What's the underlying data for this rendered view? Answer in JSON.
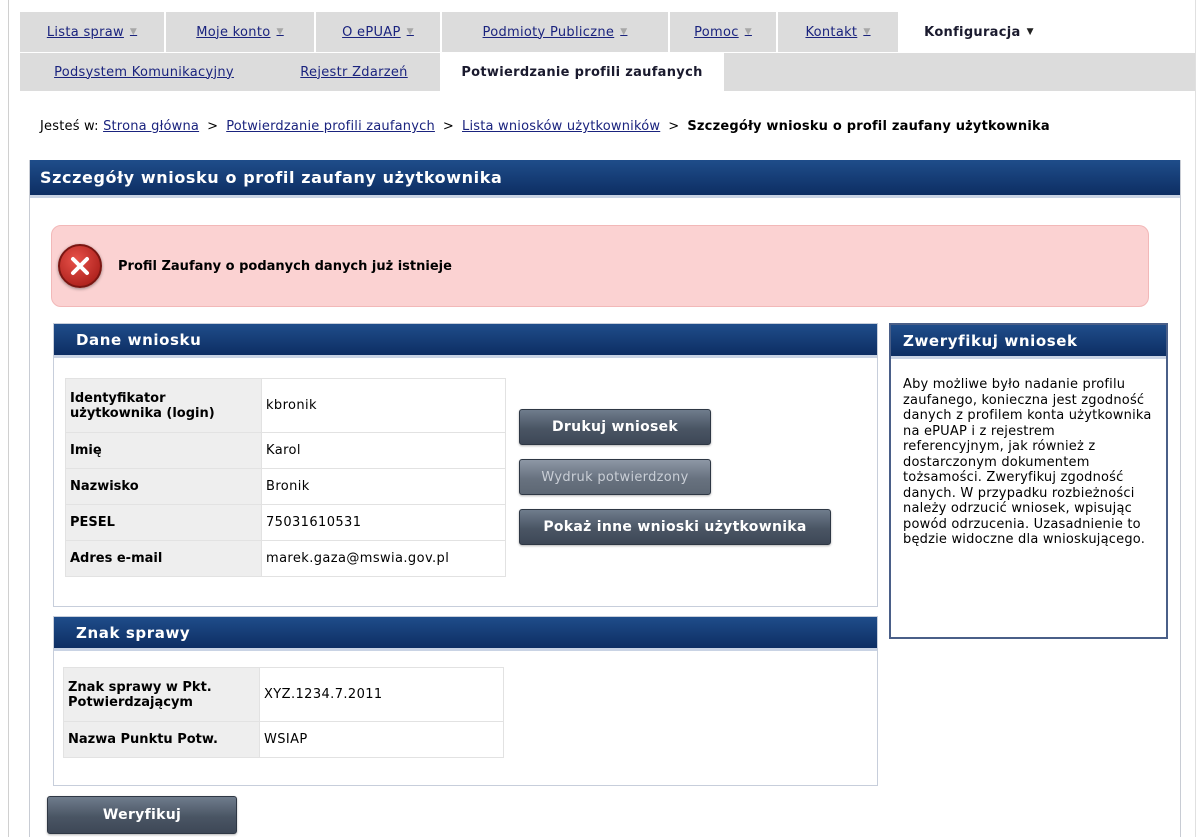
{
  "nav": {
    "main_tabs": [
      {
        "label": "Lista spraw",
        "arrow": "▼"
      },
      {
        "label": "Moje konto",
        "arrow": "▼"
      },
      {
        "label": "O ePUAP",
        "arrow": "▼"
      },
      {
        "label": "Podmioty Publiczne",
        "arrow": "▼"
      },
      {
        "label": "Pomoc",
        "arrow": "▼"
      },
      {
        "label": "Kontakt",
        "arrow": "▼"
      },
      {
        "label": "Konfiguracja",
        "arrow": "▼"
      }
    ],
    "sub_tabs": [
      {
        "label": "Podsystem Komunikacyjny"
      },
      {
        "label": "Rejestr Zdarzeń"
      },
      {
        "label": "Potwierdzanie profili zaufanych"
      }
    ]
  },
  "breadcrumb": {
    "prefix": "Jesteś w:",
    "items": [
      "Strona główna",
      "Potwierdzanie profili zaufanych",
      "Lista wniosków użytkowników"
    ],
    "separator": ">",
    "current": "Szczegóły wniosku o profil zaufany użytkownika"
  },
  "page": {
    "title": "Szczegóły wniosku o profil zaufany użytkownika",
    "error_message": "Profil Zaufany o podanych danych już istnieje"
  },
  "dane": {
    "title": "Dane wniosku",
    "rows": [
      {
        "label": "Identyfikator użytkownika (login)",
        "value": "kbronik"
      },
      {
        "label": "Imię",
        "value": "Karol"
      },
      {
        "label": "Nazwisko",
        "value": "Bronik"
      },
      {
        "label": "PESEL",
        "value": "75031610531"
      },
      {
        "label": "Adres e-mail",
        "value": "marek.gaza@mswia.gov.pl"
      }
    ],
    "buttons": {
      "print": "Drukuj wniosek",
      "print_confirmed": "Wydruk potwierdzony",
      "other_requests": "Pokaż inne wnioski użytkownika"
    }
  },
  "znak": {
    "title": "Znak sprawy",
    "rows": [
      {
        "label": "Znak sprawy w Pkt. Potwierdzającym",
        "value": "XYZ.1234.7.2011"
      },
      {
        "label": "Nazwa Punktu Potw.",
        "value": "WSIAP"
      }
    ]
  },
  "verify": {
    "title": "Zweryfikuj wniosek",
    "text": "Aby możliwe było nadanie profilu zaufanego, konieczna jest zgodność danych z profilem konta użytkownika na ePUAP i z rejestrem referencyjnym, jak również z dostarczonym dokumentem tożsamości. Zweryfikuj zgodność danych. W przypadku rozbieżności należy odrzucić wniosek, wpisując powód odrzucenia. Uzasadnienie to będzie widoczne dla wnioskującego."
  },
  "actions": {
    "verify_button": "Weryfikuj"
  },
  "colors": {
    "header_blue": "#0d2e63",
    "link": "#1a237e",
    "error_bg": "#fbd2d2",
    "error_icon": "#c0201a"
  },
  "icons": {
    "error": "error-x-icon",
    "dropdown": "chevron-down-icon"
  }
}
